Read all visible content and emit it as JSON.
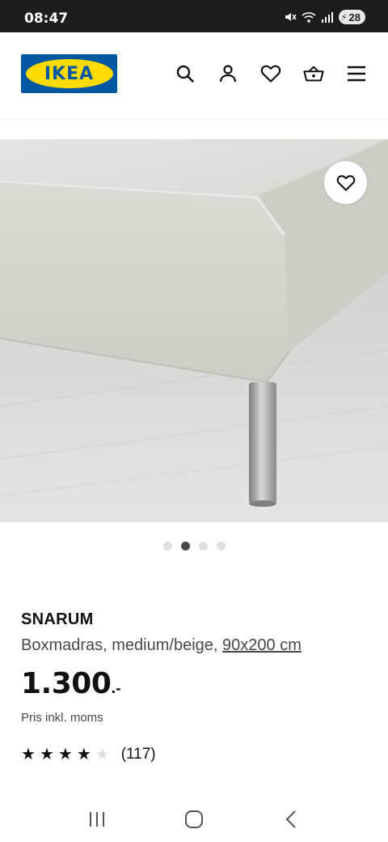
{
  "status_bar": {
    "time": "08:47",
    "battery": "28",
    "icons": [
      "mute-icon",
      "wifi-icon",
      "signal-icon",
      "battery-icon"
    ]
  },
  "header": {
    "logo_text": "IKEA",
    "icons": [
      "search-icon",
      "account-icon",
      "wishlist-heart-icon",
      "cart-basket-icon",
      "menu-icon"
    ]
  },
  "gallery": {
    "image_count": 4,
    "active_index": 1
  },
  "product": {
    "name": "SNARUM",
    "description": "Boxmadras, medium/beige, ",
    "size": "90x200 cm",
    "price": "1.300",
    "price_suffix": ".-",
    "price_note": "Pris inkl. moms",
    "rating": 4,
    "rating_max": 5,
    "review_count": "(117)"
  },
  "colors": {
    "ikea_blue": "#0058a3",
    "ikea_yellow": "#ffdb00",
    "text": "#111111",
    "muted": "#484848"
  },
  "nav": {
    "buttons": [
      "recent-apps-icon",
      "home-icon",
      "back-icon"
    ]
  }
}
